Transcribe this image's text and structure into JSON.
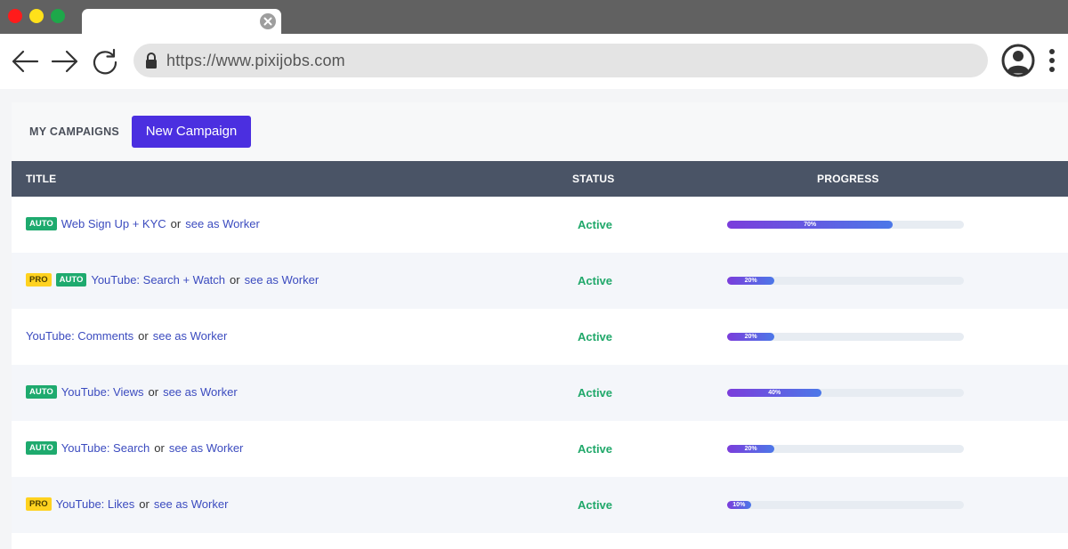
{
  "browser": {
    "url": "https://www.pixijobs.com",
    "icons": [
      "back-arrow-icon",
      "forward-arrow-icon",
      "reload-icon",
      "lock-icon",
      "account-icon",
      "more-vert-icon",
      "tab-close-icon"
    ]
  },
  "header": {
    "section_label": "MY CAMPAIGNS",
    "new_campaign_label": "New Campaign"
  },
  "table": {
    "columns": [
      "TITLE",
      "STATUS",
      "PROGRESS"
    ],
    "or_text": "or",
    "worker_link_text": "see as Worker",
    "rows": [
      {
        "badges": [
          "AUTO"
        ],
        "title": "Web Sign Up + KYC",
        "status": "Active",
        "progress": 70,
        "progress_label": "70%"
      },
      {
        "badges": [
          "PRO",
          "AUTO"
        ],
        "title": "YouTube: Search + Watch",
        "status": "Active",
        "progress": 20,
        "progress_label": "20%"
      },
      {
        "badges": [],
        "title": "YouTube: Comments",
        "status": "Active",
        "progress": 20,
        "progress_label": "20%"
      },
      {
        "badges": [
          "AUTO"
        ],
        "title": "YouTube: Views",
        "status": "Active",
        "progress": 40,
        "progress_label": "40%"
      },
      {
        "badges": [
          "AUTO"
        ],
        "title": "YouTube: Search",
        "status": "Active",
        "progress": 20,
        "progress_label": "20%"
      },
      {
        "badges": [
          "PRO"
        ],
        "title": "YouTube: Likes",
        "status": "Active",
        "progress": 10,
        "progress_label": "10%"
      }
    ]
  },
  "colors": {
    "accent": "#4b2fe0",
    "table_header": "#4a5466",
    "status_active": "#20a86a",
    "badge_auto": "#1eaa6e",
    "badge_pro": "#ffd21f",
    "link": "#3b4bbf"
  }
}
